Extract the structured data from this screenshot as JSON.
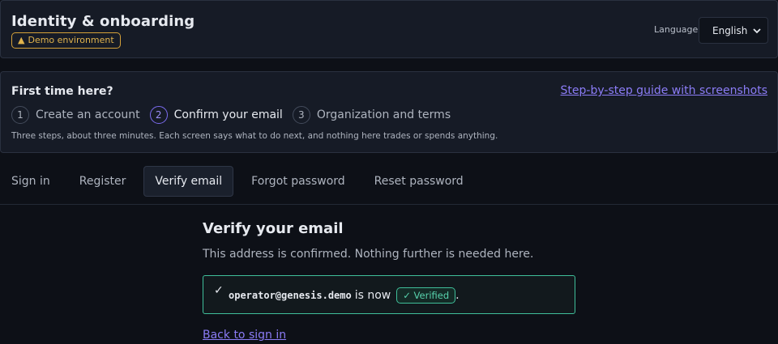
{
  "header": {
    "title": "Identity & onboarding",
    "env_badge": "Demo environment",
    "env_icon": "warning-triangle-icon",
    "language_label": "Language",
    "language_value": "English"
  },
  "intro": {
    "title": "First time here?",
    "guide_link": "Step-by-step guide with screenshots",
    "steps": [
      {
        "num": "1",
        "label": "Create an account"
      },
      {
        "num": "2",
        "label": "Confirm your email"
      },
      {
        "num": "3",
        "label": "Organization and terms"
      }
    ],
    "note": "Three steps, about three minutes. Each screen says what to do next, and nothing here trades or spends anything."
  },
  "tabs": [
    "Sign in",
    "Register",
    "Verify email",
    "Forgot password",
    "Reset password"
  ],
  "active_tab": "Verify email",
  "main": {
    "title": "Verify your email",
    "subtitle": "This address is confirmed. Nothing further is needed here.",
    "check": "✓",
    "email": "operator@genesis.demo",
    "status_text": "is now",
    "badge": "✓ Verified",
    "period": ".",
    "back_link": "Back to sign in"
  },
  "colors": {
    "accent": "#8b7cf6",
    "success": "#3fbf9a",
    "warning": "#d4a13a"
  }
}
